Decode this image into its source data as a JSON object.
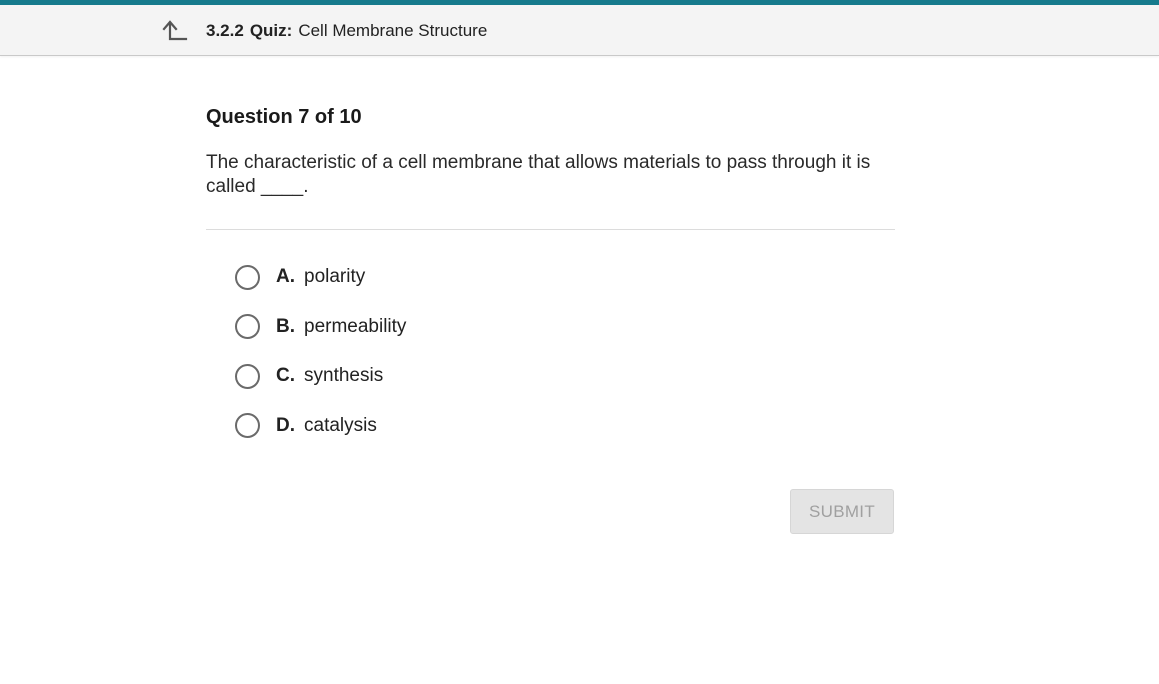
{
  "header": {
    "code": "3.2.2",
    "kind": "Quiz:",
    "title": "Cell Membrane Structure",
    "back_icon": "back-arrow-icon"
  },
  "colors": {
    "accent": "#167a8c",
    "header_bg": "#f4f4f4",
    "submit_bg": "#e4e4e4",
    "submit_text": "#a0a0a0"
  },
  "question": {
    "number_label": "Question 7 of 10",
    "text": "The characteristic of a cell membrane that allows materials to pass through it is called ____."
  },
  "options": [
    {
      "letter": "A.",
      "text": "polarity"
    },
    {
      "letter": "B.",
      "text": "permeability"
    },
    {
      "letter": "C.",
      "text": "synthesis"
    },
    {
      "letter": "D.",
      "text": "catalysis"
    }
  ],
  "submit": {
    "label": "SUBMIT"
  }
}
